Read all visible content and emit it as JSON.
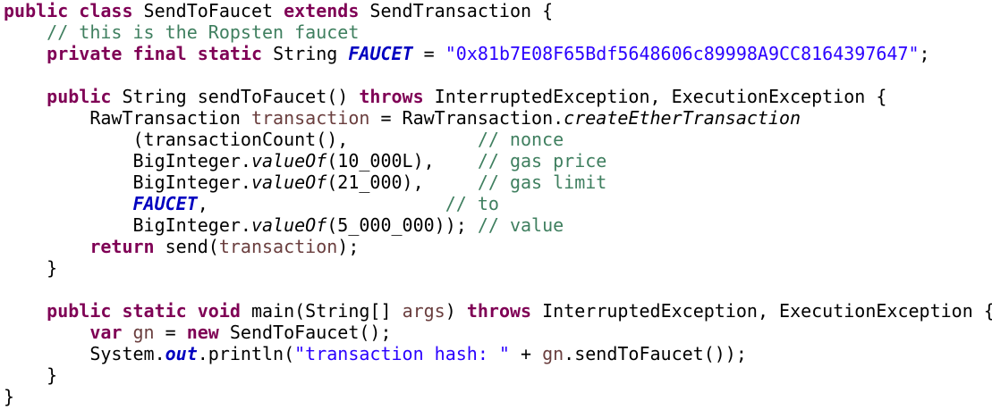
{
  "lines": [
    [
      {
        "t": "public",
        "c": "kw"
      },
      {
        "t": " "
      },
      {
        "t": "class",
        "c": "kw"
      },
      {
        "t": " SendToFaucet "
      },
      {
        "t": "extends",
        "c": "kw"
      },
      {
        "t": " SendTransaction {"
      }
    ],
    [
      {
        "t": "    "
      },
      {
        "t": "// this is the Ropsten faucet",
        "c": "cm"
      }
    ],
    [
      {
        "t": "    "
      },
      {
        "t": "private",
        "c": "kw"
      },
      {
        "t": " "
      },
      {
        "t": "final",
        "c": "kw"
      },
      {
        "t": " "
      },
      {
        "t": "static",
        "c": "kw"
      },
      {
        "t": " String "
      },
      {
        "t": "FAUCET",
        "c": "field"
      },
      {
        "t": " = "
      },
      {
        "t": "\"0x81b7E08F65Bdf5648606c89998A9CC8164397647\"",
        "c": "str"
      },
      {
        "t": ";"
      }
    ],
    [
      {
        "t": ""
      }
    ],
    [
      {
        "t": "    "
      },
      {
        "t": "public",
        "c": "kw"
      },
      {
        "t": " String sendToFaucet() "
      },
      {
        "t": "throws",
        "c": "kw"
      },
      {
        "t": " InterruptedException, ExecutionException {"
      }
    ],
    [
      {
        "t": "        RawTransaction "
      },
      {
        "t": "transaction",
        "c": "var"
      },
      {
        "t": " = RawTransaction."
      },
      {
        "t": "createEtherTransaction",
        "c": "method-static"
      }
    ],
    [
      {
        "t": "            (transactionCount(),            "
      },
      {
        "t": "// nonce",
        "c": "cm"
      }
    ],
    [
      {
        "t": "            BigInteger."
      },
      {
        "t": "valueOf",
        "c": "method-static"
      },
      {
        "t": "(10_000L),    "
      },
      {
        "t": "// gas price",
        "c": "cm"
      }
    ],
    [
      {
        "t": "            BigInteger."
      },
      {
        "t": "valueOf",
        "c": "method-static"
      },
      {
        "t": "(21_000),     "
      },
      {
        "t": "// gas limit",
        "c": "cm"
      }
    ],
    [
      {
        "t": "            "
      },
      {
        "t": "FAUCET",
        "c": "field"
      },
      {
        "t": ",                      "
      },
      {
        "t": "// to",
        "c": "cm"
      }
    ],
    [
      {
        "t": "            BigInteger."
      },
      {
        "t": "valueOf",
        "c": "method-static"
      },
      {
        "t": "(5_000_000)); "
      },
      {
        "t": "// value",
        "c": "cm"
      }
    ],
    [
      {
        "t": "        "
      },
      {
        "t": "return",
        "c": "kw"
      },
      {
        "t": " send("
      },
      {
        "t": "transaction",
        "c": "var"
      },
      {
        "t": ");"
      }
    ],
    [
      {
        "t": "    }"
      }
    ],
    [
      {
        "t": ""
      }
    ],
    [
      {
        "t": "    "
      },
      {
        "t": "public",
        "c": "kw"
      },
      {
        "t": " "
      },
      {
        "t": "static",
        "c": "kw"
      },
      {
        "t": " "
      },
      {
        "t": "void",
        "c": "kw"
      },
      {
        "t": " main(String[] "
      },
      {
        "t": "args",
        "c": "var"
      },
      {
        "t": ") "
      },
      {
        "t": "throws",
        "c": "kw"
      },
      {
        "t": " InterruptedException, ExecutionException {"
      }
    ],
    [
      {
        "t": "        "
      },
      {
        "t": "var",
        "c": "kw"
      },
      {
        "t": " "
      },
      {
        "t": "gn",
        "c": "var"
      },
      {
        "t": " = "
      },
      {
        "t": "new",
        "c": "kw"
      },
      {
        "t": " SendToFaucet();"
      }
    ],
    [
      {
        "t": "        System."
      },
      {
        "t": "out",
        "c": "field"
      },
      {
        "t": ".println("
      },
      {
        "t": "\"transaction hash: \"",
        "c": "str"
      },
      {
        "t": " + "
      },
      {
        "t": "gn",
        "c": "var"
      },
      {
        "t": ".sendToFaucet());"
      }
    ],
    [
      {
        "t": "    }"
      }
    ],
    [
      {
        "t": "}"
      }
    ]
  ],
  "colors": {
    "keyword": "#7f0055",
    "comment": "#3f7f5f",
    "string": "#2a00ff",
    "field": "#0000c0",
    "variable": "#6a3e3e",
    "default": "#000000",
    "background": "#ffffff"
  }
}
